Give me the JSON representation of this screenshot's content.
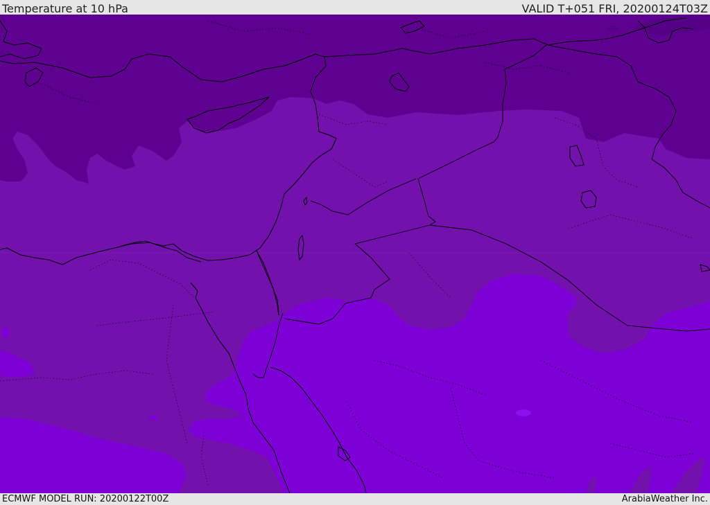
{
  "header": {
    "title": "Temperature at 10 hPa",
    "valid": "VALID T+051 FRI, 20200124T03Z"
  },
  "footer": {
    "model_run": "ECMWF MODEL RUN: 20200122T00Z",
    "credit": "ArabiaWeather Inc."
  },
  "colors": {
    "band_coldest": "#5d0091",
    "band_cold": "#6a0099",
    "band_mid": "#7311ac",
    "band_warm": "#7d00d6",
    "coastline": "#000000"
  }
}
